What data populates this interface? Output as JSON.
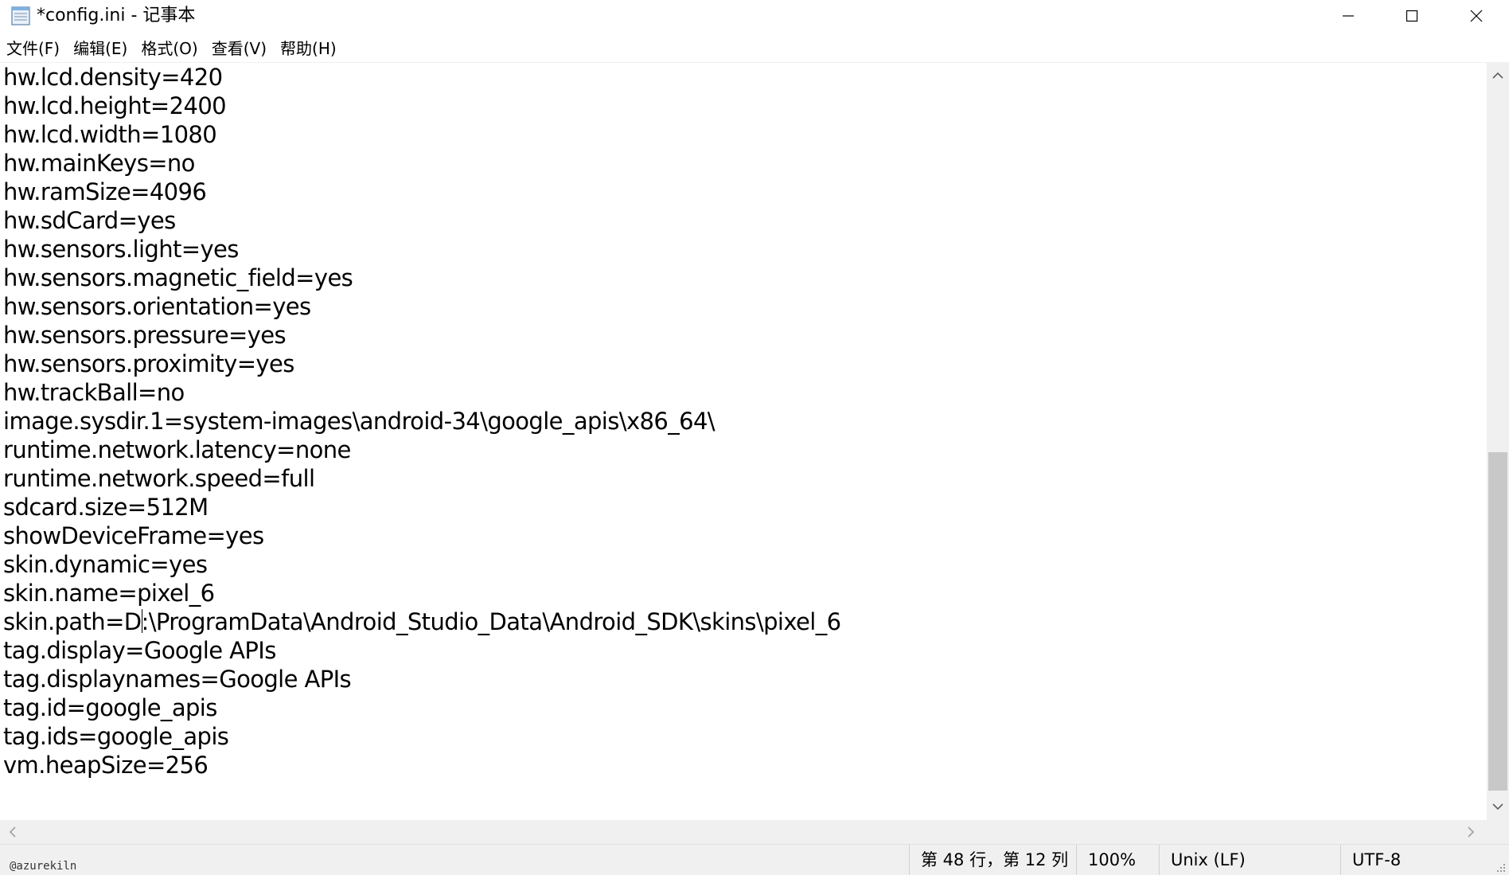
{
  "window": {
    "title": "*config.ini - 记事本",
    "icon": "notepad-icon"
  },
  "menu": [
    {
      "label": "文件(F)"
    },
    {
      "label": "编辑(E)"
    },
    {
      "label": "格式(O)"
    },
    {
      "label": "查看(V)"
    },
    {
      "label": "帮助(H)"
    }
  ],
  "editor": {
    "lines": [
      "hw.lcd.density=420",
      "hw.lcd.height=2400",
      "hw.lcd.width=1080",
      "hw.mainKeys=no",
      "hw.ramSize=4096",
      "hw.sdCard=yes",
      "hw.sensors.light=yes",
      "hw.sensors.magnetic_field=yes",
      "hw.sensors.orientation=yes",
      "hw.sensors.pressure=yes",
      "hw.sensors.proximity=yes",
      "hw.trackBall=no",
      "image.sysdir.1=system-images\\android-34\\google_apis\\x86_64\\",
      "runtime.network.latency=none",
      "runtime.network.speed=full",
      "sdcard.size=512M",
      "showDeviceFrame=yes",
      "skin.dynamic=yes",
      "skin.name=pixel_6",
      "skin.path=D:\\ProgramData\\Android_Studio_Data\\Android_SDK\\skins\\pixel_6",
      "tag.display=Google APIs",
      "tag.displaynames=Google APIs",
      "tag.id=google_apis",
      "tag.ids=google_apis",
      "vm.heapSize=256"
    ],
    "caret": {
      "line_index": 19,
      "column": 12
    }
  },
  "status": {
    "position": "第 48 行，第 12 列",
    "zoom": "100%",
    "line_ending": "Unix (LF)",
    "encoding": "UTF-8"
  },
  "watermark": "@azurekiln"
}
